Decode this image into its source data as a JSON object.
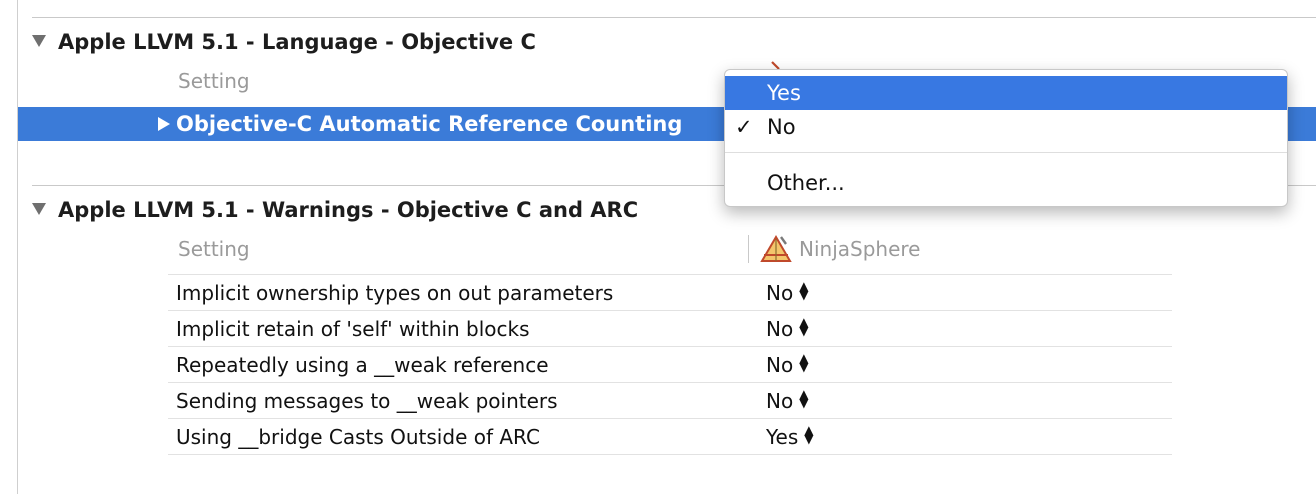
{
  "sections": [
    {
      "title": "Apple LLVM 5.1 - Language - Objective C",
      "column_header": "Setting",
      "selected_row_label": "Objective-C Automatic Reference Counting"
    },
    {
      "title": "Apple LLVM 5.1 - Warnings - Objective C and ARC",
      "column_header": "Setting",
      "target": {
        "name": "NinjaSphere",
        "icon": "xcode-app-icon"
      },
      "rows": [
        {
          "setting": "Implicit ownership types on out parameters",
          "value": "No"
        },
        {
          "setting": "Implicit retain of 'self' within blocks",
          "value": "No"
        },
        {
          "setting": "Repeatedly using a __weak reference",
          "value": "No"
        },
        {
          "setting": "Sending messages to __weak pointers",
          "value": "No"
        },
        {
          "setting": "Using __bridge Casts Outside of ARC",
          "value": "Yes"
        }
      ]
    }
  ],
  "popup_menu": {
    "items": [
      "Yes",
      "No",
      "Other..."
    ],
    "highlighted": "Yes",
    "checked": "No",
    "check_glyph": "✓"
  },
  "colors": {
    "selection": "#3b7bd8",
    "menu_highlight": "#3878e2"
  }
}
